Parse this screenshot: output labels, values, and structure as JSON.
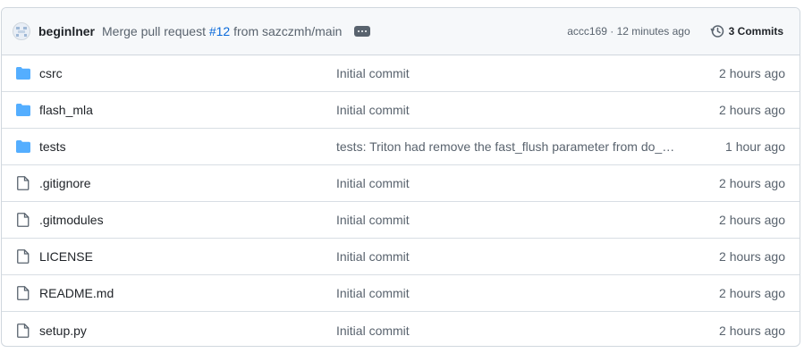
{
  "commit_bar": {
    "author": "beginlner",
    "message_prefix": "Merge pull request ",
    "pr_link": "#12",
    "message_suffix": " from sazczmh/main",
    "sha_time": "accc169 · 12 minutes ago",
    "commits_label": "3 Commits"
  },
  "files": [
    {
      "type": "folder",
      "name": "csrc",
      "message": "Initial commit",
      "time": "2 hours ago"
    },
    {
      "type": "folder",
      "name": "flash_mla",
      "message": "Initial commit",
      "time": "2 hours ago"
    },
    {
      "type": "folder",
      "name": "tests",
      "message": "tests: Triton had remove the fast_flush parameter from do_b...",
      "time": "1 hour ago"
    },
    {
      "type": "file",
      "name": ".gitignore",
      "message": "Initial commit",
      "time": "2 hours ago"
    },
    {
      "type": "file",
      "name": ".gitmodules",
      "message": "Initial commit",
      "time": "2 hours ago"
    },
    {
      "type": "file",
      "name": "LICENSE",
      "message": "Initial commit",
      "time": "2 hours ago"
    },
    {
      "type": "file",
      "name": "README.md",
      "message": "Initial commit",
      "time": "2 hours ago"
    },
    {
      "type": "file",
      "name": "setup.py",
      "message": "Initial commit",
      "time": "2 hours ago"
    }
  ],
  "colors": {
    "folder_icon": "#54aeff",
    "file_icon": "#59636e",
    "link": "#0969da"
  },
  "icons": {
    "folder": "folder-icon",
    "file": "file-icon",
    "history": "history-icon",
    "more": "ellipsis-icon"
  }
}
